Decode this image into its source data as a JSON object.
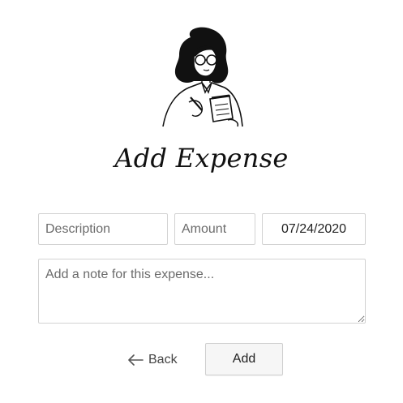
{
  "page": {
    "title": "Add Expense"
  },
  "illustration": {
    "icon": "woman-with-notepad-icon"
  },
  "form": {
    "description": {
      "placeholder": "Description",
      "value": ""
    },
    "amount": {
      "placeholder": "Amount",
      "value": ""
    },
    "date": {
      "value": "07/24/2020"
    },
    "note": {
      "placeholder": "Add a note for this expense...",
      "value": ""
    }
  },
  "actions": {
    "back_label": "Back",
    "back_icon": "arrow-left-icon",
    "add_label": "Add"
  }
}
